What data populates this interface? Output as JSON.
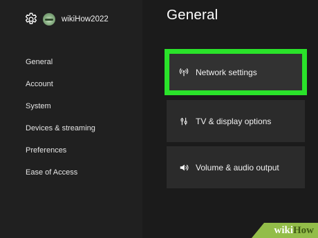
{
  "profile": {
    "username": "wikiHow2022",
    "icon": "gear-icon"
  },
  "sidebar": {
    "items": [
      {
        "label": "General"
      },
      {
        "label": "Account"
      },
      {
        "label": "System"
      },
      {
        "label": "Devices & streaming"
      },
      {
        "label": "Preferences"
      },
      {
        "label": "Ease of Access"
      }
    ]
  },
  "main": {
    "title": "General",
    "tiles": [
      {
        "label": "Network settings",
        "icon": "network-icon",
        "focused": true
      },
      {
        "label": "TV & display options",
        "icon": "display-options-icon",
        "focused": false
      },
      {
        "label": "Volume & audio output",
        "icon": "speaker-icon",
        "focused": false
      }
    ]
  },
  "colors": {
    "focus": "#2ae32a",
    "background": "#1b1b1b",
    "tile": "#2b2b2b"
  },
  "watermark": {
    "part1": "wiki",
    "part2": "How"
  }
}
